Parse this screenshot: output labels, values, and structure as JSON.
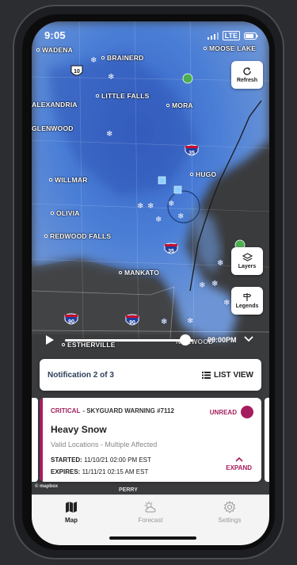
{
  "status_bar": {
    "time": "9:05",
    "network": "LTE"
  },
  "map": {
    "cities": [
      "WADENA",
      "BRAINERD",
      "MOOSE LAKE",
      "LITTLE FALLS",
      "ALEXANDRIA",
      "MORA",
      "GLENWOOD",
      "HUGO",
      "WILLMAR",
      "OLIVIA",
      "REDWOOD FALLS",
      "MANKATO",
      "ESTHERVILLE",
      "NORWOOD",
      "PERRY"
    ],
    "routes": {
      "us10": "10",
      "i35_north": "35",
      "i35_south": "35",
      "i90_west": "90",
      "i90_east": "90"
    },
    "attribution": "© mapbox"
  },
  "controls": {
    "refresh_label": "Refresh",
    "layers_label": "Layers",
    "legends_label": "Legends"
  },
  "playback": {
    "time": "09:00PM",
    "progress": 0.94
  },
  "notification": {
    "counter": "Notification 2 of 3",
    "list_view_label": "LIST VIEW",
    "severity": "CRITICAL",
    "source": "- SKYGUARD WARNING #7112",
    "status": "UNREAD",
    "title": "Heavy Snow",
    "locations": "Valid Locations - Multiple Affected",
    "started_label": "STARTED:",
    "started_value": "11/10/21 02:00 PM EST",
    "expires_label": "EXPIRES:",
    "expires_value": "11/11/21 02:15 AM EST",
    "expand_label": "EXPAND"
  },
  "tabs": [
    {
      "label": "Map",
      "icon": "map-icon",
      "active": true
    },
    {
      "label": "Forecast",
      "icon": "partly-cloudy-icon",
      "active": false
    },
    {
      "label": "Settings",
      "icon": "gear-icon",
      "active": false
    }
  ],
  "colors": {
    "accent": "#a51d5d",
    "radar_blue": "#3f74d0",
    "land": "#3a3b3d"
  }
}
